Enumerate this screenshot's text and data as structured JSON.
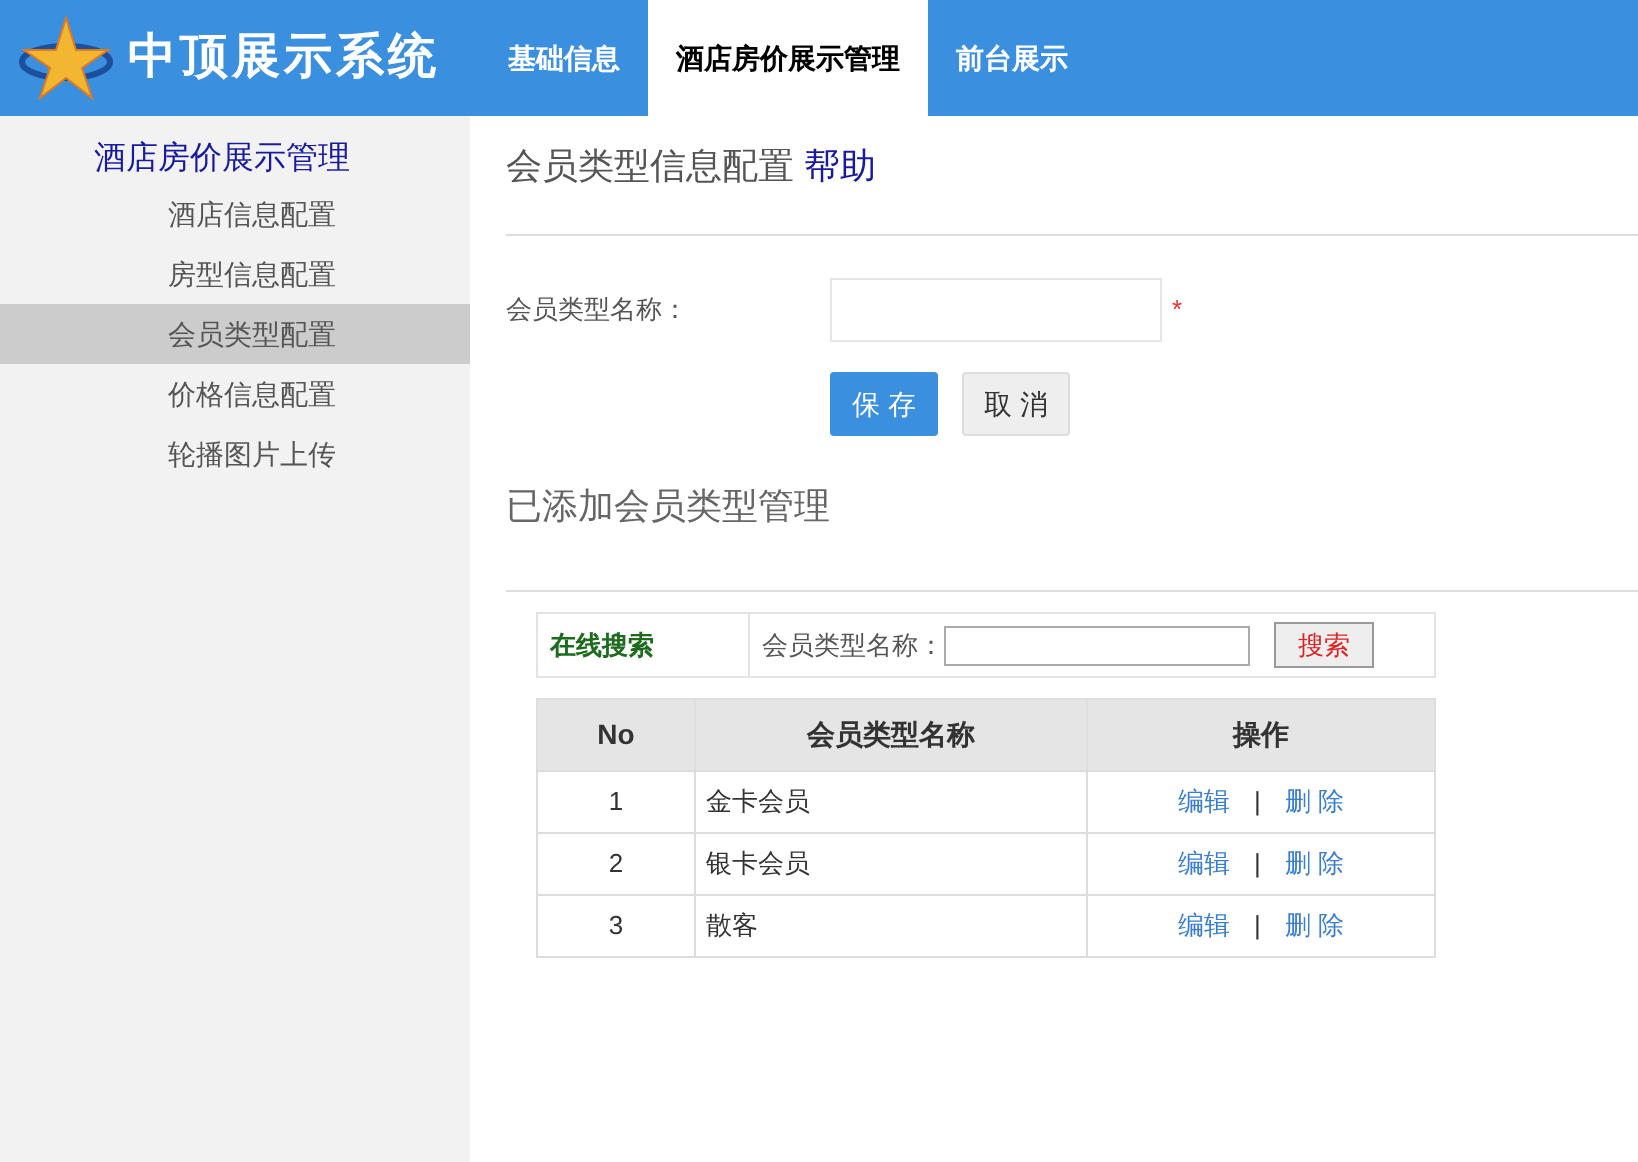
{
  "header": {
    "logo_text": "中顶展示系统",
    "tabs": [
      {
        "label": "基础信息",
        "selected": false
      },
      {
        "label": "酒店房价展示管理",
        "selected": true
      },
      {
        "label": "前台展示",
        "selected": false
      }
    ]
  },
  "sidebar": {
    "title": "酒店房价展示管理",
    "items": [
      {
        "label": "酒店信息配置",
        "selected": false
      },
      {
        "label": "房型信息配置",
        "selected": false
      },
      {
        "label": "会员类型配置",
        "selected": true
      },
      {
        "label": "价格信息配置",
        "selected": false
      },
      {
        "label": "轮播图片上传",
        "selected": false
      }
    ]
  },
  "form": {
    "title": "会员类型信息配置",
    "help": "帮助",
    "field_label": "会员类型名称：",
    "required_mark": "*",
    "save": "保 存",
    "cancel": "取 消"
  },
  "list_title": "已添加会员类型管理",
  "search": {
    "label": "在线搜索",
    "field_label": "会员类型名称：",
    "button": "搜索"
  },
  "table": {
    "columns": [
      "No",
      "会员类型名称",
      "操作"
    ],
    "rows": [
      {
        "no": "1",
        "name": "金卡会员",
        "edit": "编辑",
        "sep": "|",
        "delete": "删 除"
      },
      {
        "no": "2",
        "name": "银卡会员",
        "edit": "编辑",
        "sep": "|",
        "delete": "删 除"
      },
      {
        "no": "3",
        "name": "散客",
        "edit": "编辑",
        "sep": "|",
        "delete": "删 除"
      }
    ]
  }
}
